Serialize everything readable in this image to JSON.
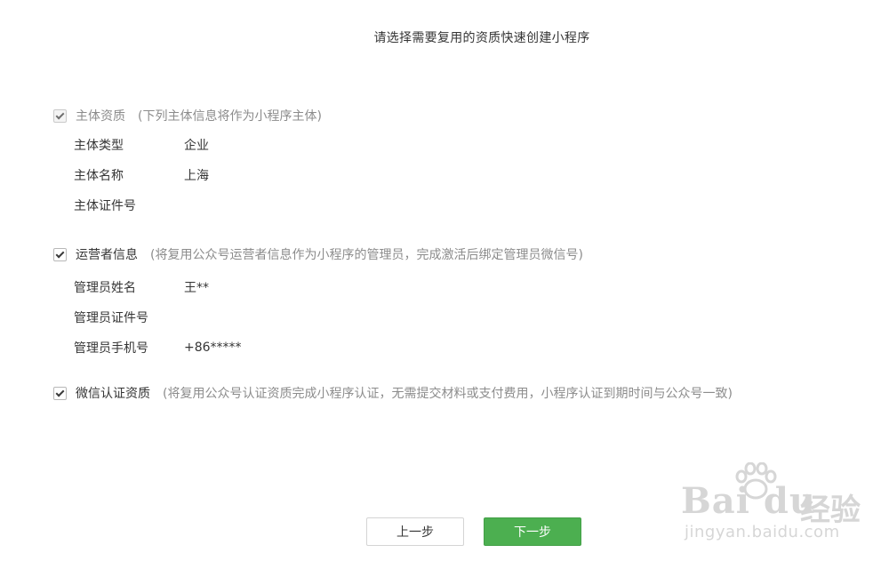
{
  "header": {
    "title": "请选择需要复用的资质快速创建小程序"
  },
  "sections": [
    {
      "label": "主体资质",
      "note": "(下列主体信息将作为小程序主体)",
      "checked": true,
      "disabled": true,
      "rows": [
        {
          "label": "主体类型",
          "value": "企业"
        },
        {
          "label": "主体名称",
          "value": "上海"
        },
        {
          "label": "主体证件号",
          "value": ""
        }
      ]
    },
    {
      "label": "运营者信息",
      "note": "(将复用公众号运营者信息作为小程序的管理员，完成激活后绑定管理员微信号)",
      "checked": true,
      "disabled": false,
      "rows": [
        {
          "label": "管理员姓名",
          "value": "王**"
        },
        {
          "label": "管理员证件号",
          "value": ""
        },
        {
          "label": "管理员手机号",
          "value": "+86*****"
        }
      ]
    },
    {
      "label": "微信认证资质",
      "note": "(将复用公众号认证资质完成小程序认证，无需提交材料或支付费用，小程序认证到期时间与公众号一致)",
      "checked": true,
      "disabled": false,
      "rows": []
    }
  ],
  "buttons": {
    "prev": "上一步",
    "next": "下一步"
  },
  "watermark": {
    "logo": "Bai du",
    "cn": "经验",
    "url": "jingyan.baidu.com"
  },
  "colors": {
    "primary_green": "#4caf50",
    "text": "#353535",
    "note": "#8c8c8c"
  }
}
